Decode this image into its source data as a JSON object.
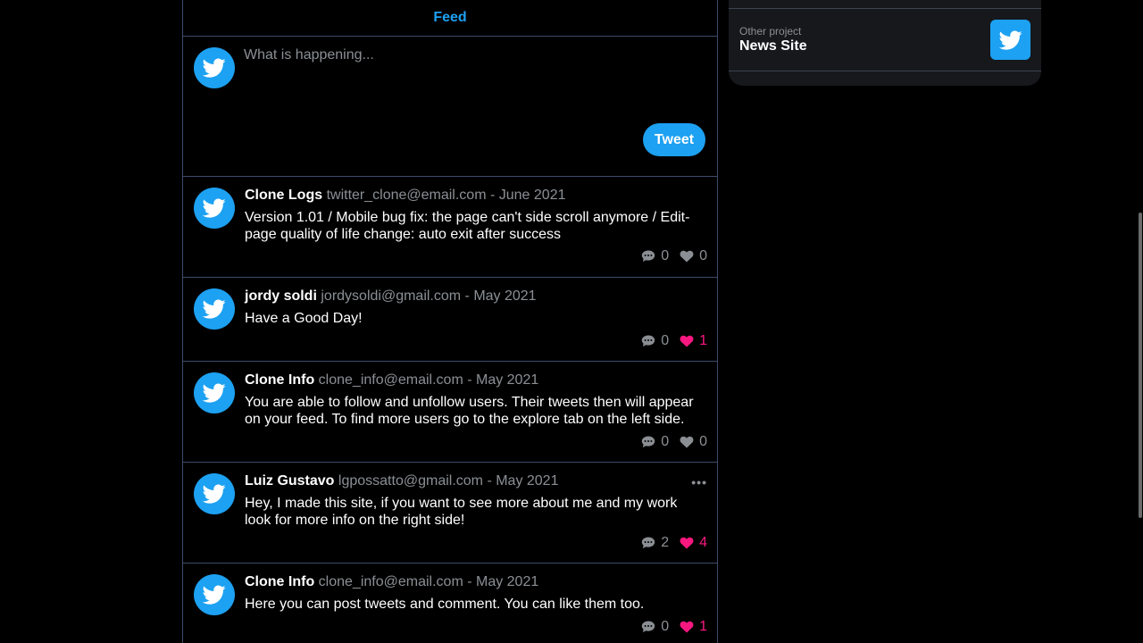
{
  "feed": {
    "title": "Feed"
  },
  "composer": {
    "placeholder": "What is happening...",
    "tweet_label": "Tweet"
  },
  "posts": [
    {
      "author": "Clone Logs",
      "meta": "twitter_clone@email.com - June 2021",
      "text": "Version 1.01 / Mobile bug fix: the page can't side scroll anymore / Edit-page quality of life change: auto exit after success",
      "comments": "0",
      "likes": "0",
      "liked": false
    },
    {
      "author": "jordy soldi",
      "meta": "jordysoldi@gmail.com - May 2021",
      "text": "Have a Good Day!",
      "comments": "0",
      "likes": "1",
      "liked": true
    },
    {
      "author": "Clone Info",
      "meta": "clone_info@email.com - May 2021",
      "text": "You are able to follow and unfollow users. Their tweets then will appear on your feed. To find more users go to the explore tab on the left side.",
      "comments": "0",
      "likes": "0",
      "liked": false
    },
    {
      "author": "Luiz Gustavo",
      "meta": "lgpossatto@gmail.com - May 2021",
      "text": "Hey, I made this site, if you want to see more about me and my work look for more info on the right side!",
      "comments": "2",
      "likes": "4",
      "liked": true
    },
    {
      "author": "Clone Info",
      "meta": "clone_info@email.com - May 2021",
      "text": "Here you can post tweets and comment. You can like them too.",
      "comments": "0",
      "likes": "1",
      "liked": true
    }
  ],
  "sidebar": {
    "project_label": "Other project",
    "project_name": "News Site",
    "project_icon": "twitter-bird-icon"
  },
  "colors": {
    "accent": "#1da1f2",
    "like": "#f91880",
    "muted": "#8b8f94",
    "border": "#3d4a6b"
  }
}
